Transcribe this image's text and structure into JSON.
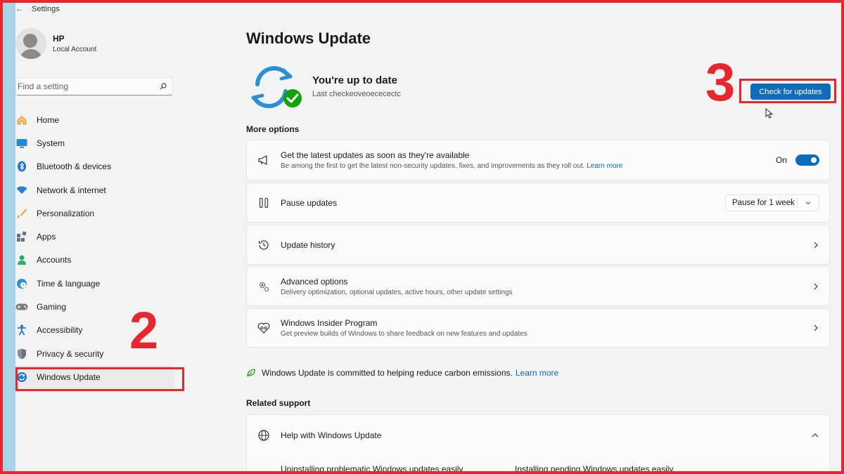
{
  "window": {
    "title": "Settings",
    "back_glyph": "←"
  },
  "profile": {
    "name": "HP",
    "account_type": "Local Account"
  },
  "search": {
    "placeholder": "Find a setting"
  },
  "sidebar": {
    "items": [
      {
        "label": "Home",
        "icon": "home-icon"
      },
      {
        "label": "System",
        "icon": "system-icon"
      },
      {
        "label": "Bluetooth & devices",
        "icon": "bluetooth-icon"
      },
      {
        "label": "Network & internet",
        "icon": "wifi-icon"
      },
      {
        "label": "Personalization",
        "icon": "brush-icon"
      },
      {
        "label": "Apps",
        "icon": "apps-icon"
      },
      {
        "label": "Accounts",
        "icon": "accounts-icon"
      },
      {
        "label": "Time & language",
        "icon": "globe-clock-icon"
      },
      {
        "label": "Gaming",
        "icon": "gamepad-icon"
      },
      {
        "label": "Accessibility",
        "icon": "accessibility-icon"
      },
      {
        "label": "Privacy & security",
        "icon": "shield-icon"
      },
      {
        "label": "Windows Update",
        "icon": "update-icon",
        "active": true
      }
    ]
  },
  "annotations": {
    "marker_2": "2",
    "marker_3": "3",
    "color": "#e8262d"
  },
  "main": {
    "title": "Windows Update",
    "status": {
      "title": "You're up to date",
      "subtitle": "Last checkeoveoececectc"
    },
    "check_button": "Check for updates",
    "more_options_title": "More options",
    "options": [
      {
        "title": "Get the latest updates as soon as they're available",
        "subtitle": "Be among the first to get the latest non-security updates, fixes, and improvements as they roll out.",
        "link": "Learn more",
        "control": "toggle",
        "control_label": "On",
        "icon": "megaphone-icon"
      },
      {
        "title": "Pause updates",
        "control": "select",
        "control_value": "Pause for 1 week",
        "icon": "pause-icon"
      },
      {
        "title": "Update history",
        "control": "chevron",
        "icon": "history-icon"
      },
      {
        "title": "Advanced options",
        "subtitle": "Delivery optimization, optional updates, active hours, other update settings",
        "control": "chevron",
        "icon": "gears-icon"
      },
      {
        "title": "Windows Insider Program",
        "subtitle": "Get preview builds of Windows to share feedback on new features and updates",
        "control": "chevron",
        "icon": "insider-icon"
      }
    ],
    "carbon": {
      "text": "Windows Update is committed to helping reduce carbon emissions.",
      "link": "Learn more"
    },
    "related_support_title": "Related support",
    "help": {
      "title": "Help with Windows Update",
      "links": [
        "Uninstalling problematic Windows updates easily",
        "Installing pending Windows updates easily"
      ]
    }
  },
  "colors": {
    "accent": "#0f6cbd",
    "success": "#13a10e",
    "sync_blue": "#2b8fd6"
  }
}
